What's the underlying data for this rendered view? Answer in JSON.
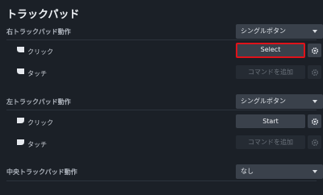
{
  "page": {
    "title": "トラックパッド"
  },
  "right_pad": {
    "label": "右トラックパッド動作",
    "mode": "シングルボタン",
    "click_label": "クリック",
    "click_binding": "Select",
    "touch_label": "タッチ",
    "touch_binding": "コマンドを追加"
  },
  "left_pad": {
    "label": "左トラックパッド動作",
    "mode": "シングルボタン",
    "click_label": "クリック",
    "click_binding": "Start",
    "touch_label": "タッチ",
    "touch_binding": "コマンドを追加"
  },
  "center_pad": {
    "label": "中央トラックパッド動作",
    "mode": "なし"
  },
  "colors": {
    "background": "#1b2027",
    "focus_border": "#e0121a",
    "control": "#3a414b",
    "control_disabled": "#252b33"
  },
  "icons": {
    "right_click": "right-trackpad-icon",
    "right_touch": "right-trackpad-icon",
    "left_click": "left-trackpad-icon",
    "left_touch": "left-trackpad-icon",
    "settings": "gear-icon",
    "dropdown": "chevron-down-icon"
  }
}
